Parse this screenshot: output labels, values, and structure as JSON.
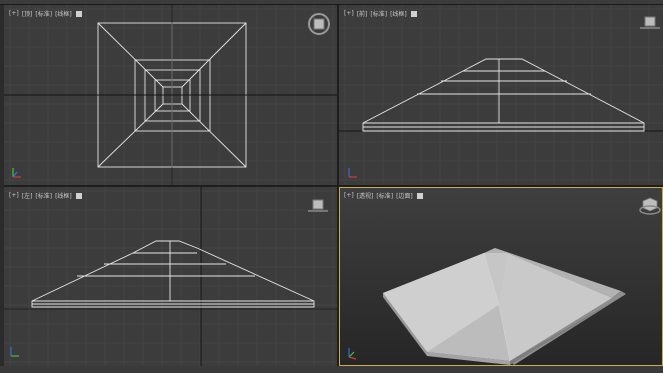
{
  "viewports": {
    "top": {
      "bracket": "[+]",
      "view": "[顶]",
      "mode": "[标准]",
      "shade": "[线框]"
    },
    "front": {
      "bracket": "[+]",
      "view": "[前]",
      "mode": "[标准]",
      "shade": "[线框]"
    },
    "left": {
      "bracket": "[+]",
      "view": "[左]",
      "mode": "[标准]",
      "shade": "[线框]"
    },
    "perspective": {
      "bracket": "[+]",
      "view": "[透视]",
      "mode": "[标准]",
      "shade": "[边面]"
    }
  },
  "colors": {
    "viewport_bg": "#3c3c3c",
    "grid": "#474747",
    "grid_major": "#141414",
    "wire": "#e6e6e6",
    "active_border": "#c9ad54",
    "axis_x": "#d13b3b",
    "axis_y": "#3bc73b",
    "axis_z": "#3b6bd1"
  },
  "icons": {
    "viewcube": "viewcube-icon",
    "axis": "axis-tripod-icon"
  }
}
